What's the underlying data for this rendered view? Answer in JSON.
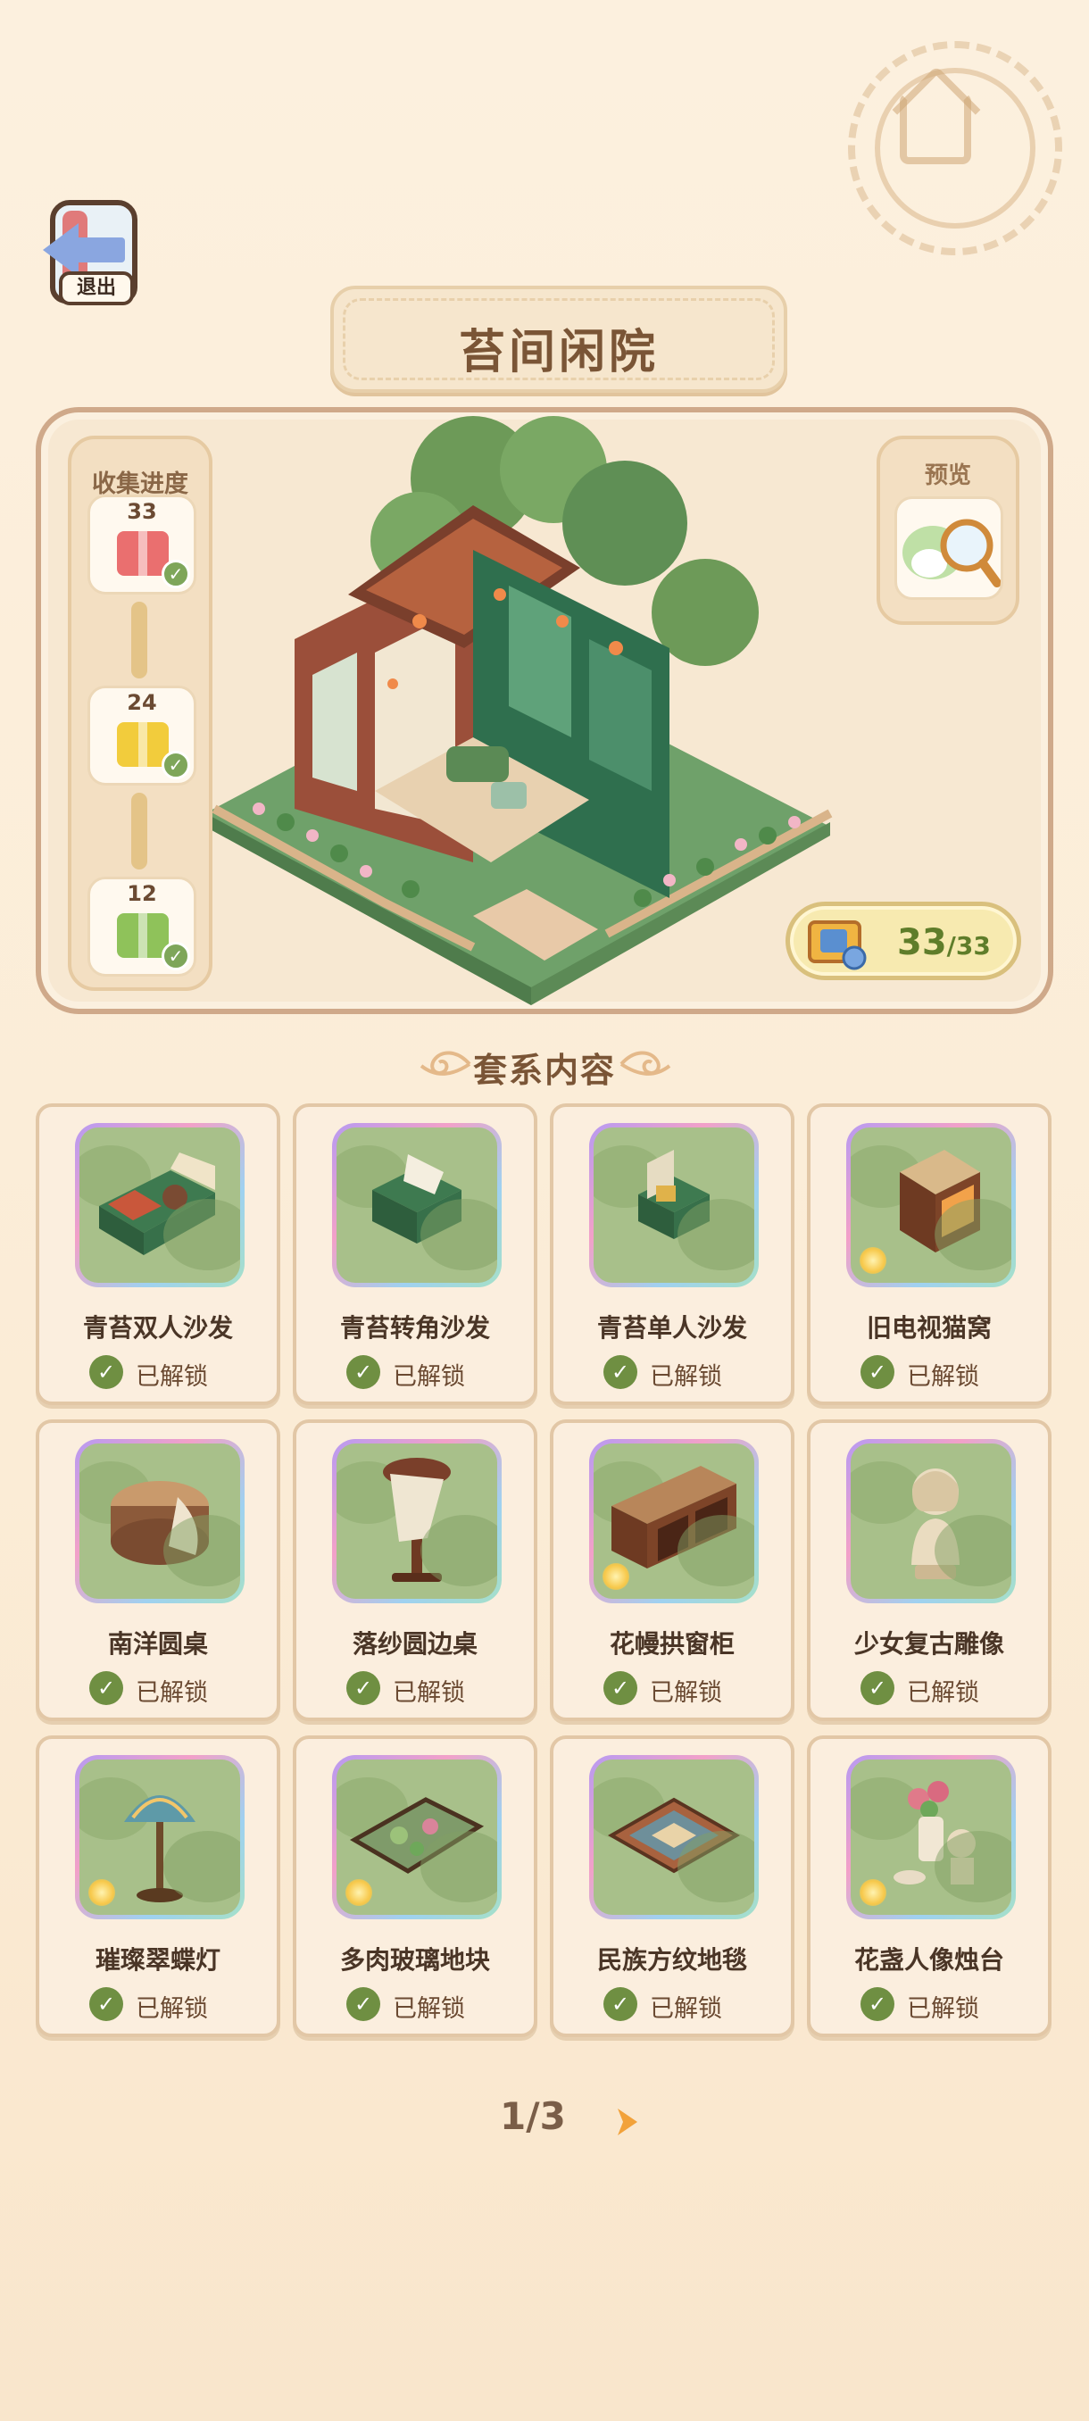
{
  "nav": {
    "exit_label": "退出",
    "home_icon": "home-stamp-icon"
  },
  "set": {
    "title": "苔间闲院",
    "progress_title": "收集进度",
    "milestones": [
      {
        "count": "33",
        "reward": "red-gift-box",
        "claimed": true
      },
      {
        "count": "24",
        "reward": "gold-gift-box",
        "claimed": true
      },
      {
        "count": "12",
        "reward": "green-gift-box",
        "claimed": true
      }
    ],
    "preview_label": "预览",
    "collected": "33",
    "total": "/33"
  },
  "section": {
    "title": "套系内容"
  },
  "items": [
    {
      "name": "青苔双人沙发",
      "status": "已解锁"
    },
    {
      "name": "青苔转角沙发",
      "status": "已解锁"
    },
    {
      "name": "青苔单人沙发",
      "status": "已解锁"
    },
    {
      "name": "旧电视猫窝",
      "status": "已解锁"
    },
    {
      "name": "南洋圆桌",
      "status": "已解锁"
    },
    {
      "name": "落纱圆边桌",
      "status": "已解锁"
    },
    {
      "name": "花幔拱窗柜",
      "status": "已解锁"
    },
    {
      "name": "少女复古雕像",
      "status": "已解锁"
    },
    {
      "name": "璀璨翠蝶灯",
      "status": "已解锁"
    },
    {
      "name": "多肉玻璃地块",
      "status": "已解锁"
    },
    {
      "name": "民族方纹地毯",
      "status": "已解锁"
    },
    {
      "name": "花盏人像烛台",
      "status": "已解锁"
    }
  ],
  "pager": {
    "label": "1/3"
  },
  "colors": {
    "background": "#fbeedb",
    "accent_green": "#6f8f42",
    "title_brown": "#7a5536",
    "card_border": "#e2c7a6"
  }
}
